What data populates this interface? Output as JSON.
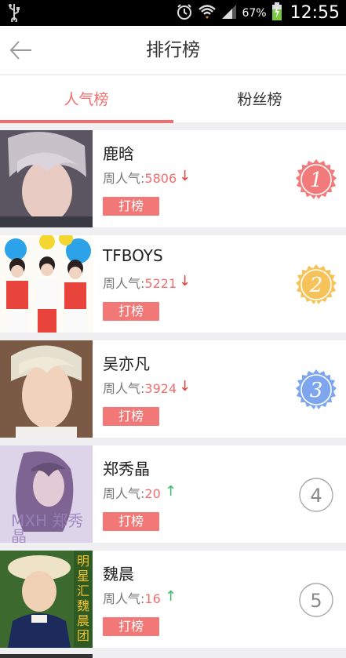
{
  "status_bar": {
    "battery_percent": "67%",
    "time": "12:55"
  },
  "header": {
    "title": "排行榜"
  },
  "tabs": [
    {
      "label": "人气榜",
      "active": true
    },
    {
      "label": "粉丝榜",
      "active": false
    }
  ],
  "list": [
    {
      "rank": "1",
      "name": "鹿晗",
      "pop_label": "周人气:",
      "pop_value": "5806",
      "trend": "down",
      "button": "打榜",
      "medal_color": "#f27a7a"
    },
    {
      "rank": "2",
      "name": "TFBOYS",
      "pop_label": "周人气:",
      "pop_value": "5221",
      "trend": "down",
      "button": "打榜",
      "medal_color": "#f6c25a"
    },
    {
      "rank": "3",
      "name": "吴亦凡",
      "pop_label": "周人气:",
      "pop_value": "3924",
      "trend": "down",
      "button": "打榜",
      "medal_color": "#7da6ee"
    },
    {
      "rank": "4",
      "name": "郑秀晶",
      "pop_label": "周人气:",
      "pop_value": "20",
      "trend": "up",
      "button": "打榜",
      "medal_color": null
    },
    {
      "rank": "5",
      "name": "魏晨",
      "pop_label": "周人气:",
      "pop_value": "16",
      "trend": "up",
      "button": "打榜",
      "medal_color": null
    }
  ],
  "thumbnail_overlay_text": {
    "row4": "MXH 郑秀晶",
    "row5": "明星汇 魏晨团"
  },
  "colors": {
    "accent": "#f26e6e",
    "down": "#e0453b",
    "up": "#3bbf6d"
  }
}
